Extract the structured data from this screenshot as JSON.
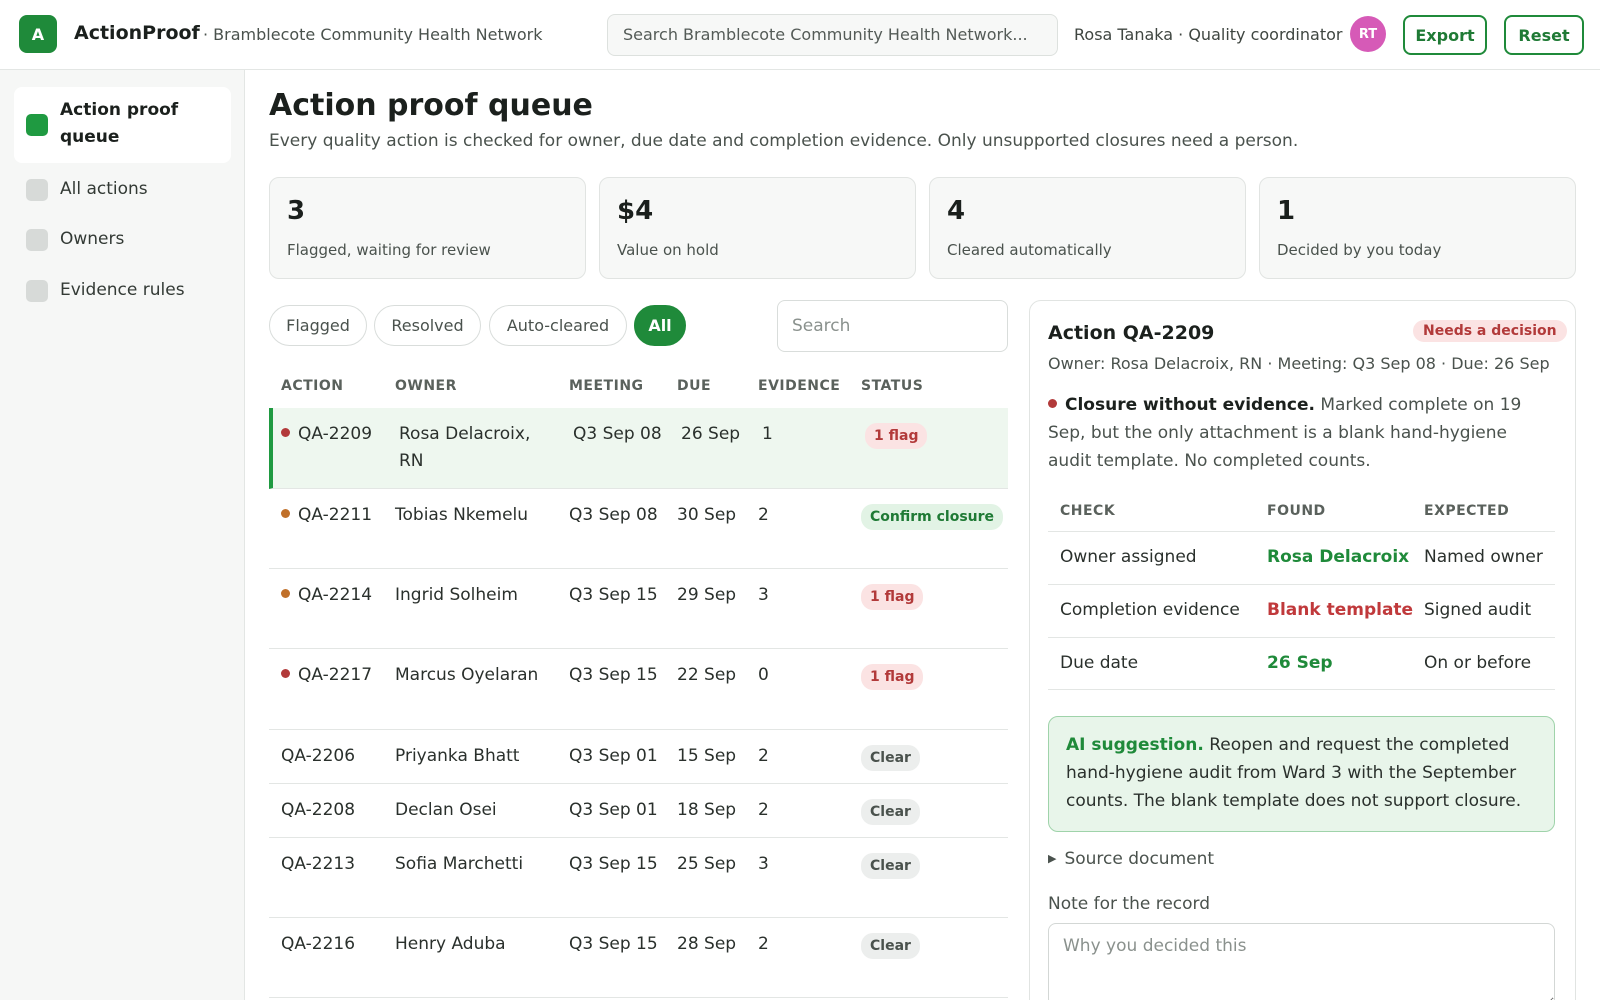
{
  "header": {
    "logo_letter": "A",
    "app_name": "ActionProof",
    "org_name": "· Bramblecote Community Health Network",
    "search_text": "Search Bramblecote Community Health Network...",
    "user": "Rosa Tanaka · Quality coordinator",
    "avatar_initials": "RT",
    "export_label": "Export",
    "reset_label": "Reset"
  },
  "sidebar": {
    "items": [
      {
        "label": "Action proof queue",
        "active": true
      },
      {
        "label": "All actions"
      },
      {
        "label": "Owners"
      },
      {
        "label": "Evidence rules"
      }
    ]
  },
  "page": {
    "title": "Action proof queue",
    "subtitle": "Every quality action is checked for owner, due date and completion evidence. Only unsupported closures need a person."
  },
  "stats": [
    {
      "value": "3",
      "label": "Flagged, waiting for review"
    },
    {
      "value": "$4",
      "label": "Value on hold"
    },
    {
      "value": "4",
      "label": "Cleared automatically"
    },
    {
      "value": "1",
      "label": "Decided by you today"
    }
  ],
  "filters": {
    "chips": [
      "Flagged",
      "Resolved",
      "Auto-cleared",
      "All"
    ],
    "active": "All",
    "search_placeholder": "Search"
  },
  "table": {
    "columns": [
      "ACTION",
      "OWNER",
      "MEETING",
      "DUE",
      "EVIDENCE",
      "STATUS"
    ],
    "rows": [
      {
        "action": "QA-2209",
        "owner": "Rosa Delacroix, RN",
        "meeting": "Q3 Sep 08",
        "due": "26 Sep",
        "evidence": "1",
        "status": "1 flag"
      },
      {
        "action": "QA-2211",
        "owner": "Tobias Nkemelu",
        "meeting": "Q3 Sep 08",
        "due": "30 Sep",
        "evidence": "2",
        "status": "Confirm closure"
      },
      {
        "action": "QA-2214",
        "owner": "Ingrid Solheim",
        "meeting": "Q3 Sep 15",
        "due": "29 Sep",
        "evidence": "3",
        "status": "1 flag"
      },
      {
        "action": "QA-2217",
        "owner": "Marcus Oyelaran",
        "meeting": "Q3 Sep 15",
        "due": "22 Sep",
        "evidence": "0",
        "status": "1 flag"
      },
      {
        "action": "QA-2206",
        "owner": "Priyanka Bhatt",
        "meeting": "Q3 Sep 01",
        "due": "15 Sep",
        "evidence": "2",
        "status": "Clear"
      },
      {
        "action": "QA-2208",
        "owner": "Declan Osei",
        "meeting": "Q3 Sep 01",
        "due": "18 Sep",
        "evidence": "2",
        "status": "Clear"
      },
      {
        "action": "QA-2213",
        "owner": "Sofia Marchetti",
        "meeting": "Q3 Sep 15",
        "due": "25 Sep",
        "evidence": "3",
        "status": "Clear"
      },
      {
        "action": "QA-2216",
        "owner": "Henry Aduba",
        "meeting": "Q3 Sep 15",
        "due": "28 Sep",
        "evidence": "2",
        "status": "Clear"
      }
    ]
  },
  "detail": {
    "title": "Action QA-2209",
    "badge": "Needs a decision",
    "meta": "Owner: Rosa Delacroix, RN · Meeting: Q3 Sep 08 · Due: 26 Sep",
    "finding_title": "Closure without evidence.",
    "finding_text": "Marked complete on 19 Sep, but the only attachment is a blank hand-hygiene audit template. No completed counts.",
    "checks_header": [
      "CHECK",
      "FOUND",
      "EXPECTED"
    ],
    "checks": [
      {
        "check": "Owner assigned",
        "found": "Rosa Delacroix",
        "expected": "Named owner"
      },
      {
        "check": "Completion evidence",
        "found": "Blank template",
        "expected": "Signed audit"
      },
      {
        "check": "Due date",
        "found": "26 Sep",
        "expected": "On or before"
      }
    ],
    "ai_label": "AI suggestion.",
    "ai_text": "Reopen and request the completed hand-hygiene audit from Ward 3 with the September counts. The blank template does not support closure.",
    "source_label": "Source document",
    "note_label": "Note for the record",
    "note_placeholder": "Why you decided this"
  },
  "colors": {
    "accent": "#1f8a3a",
    "flag": "#b23a3a",
    "warning_dot": "#c0702a",
    "avatar": "#d65ab7"
  }
}
